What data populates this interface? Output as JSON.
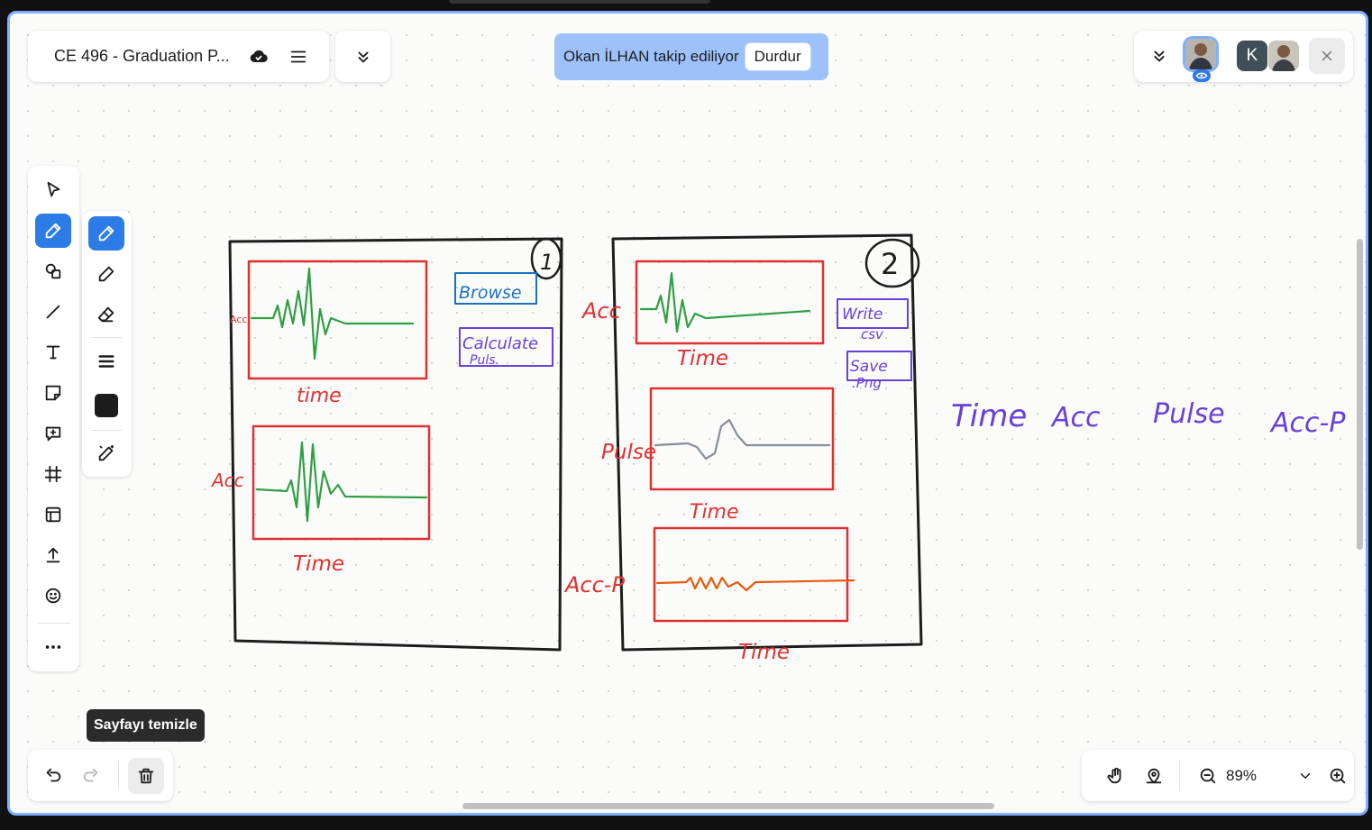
{
  "document": {
    "title": "CE 496 - Graduation P..."
  },
  "follow": {
    "text": "Okan İLHAN takip ediliyor",
    "stop_label": "Durdur"
  },
  "collaborators": {
    "second_initial": "K"
  },
  "toolbar": {
    "tools": [
      "select-icon",
      "draw-icon",
      "shapes-icon",
      "line-icon",
      "text-icon",
      "sticky-note-icon",
      "comment-icon",
      "frame-icon",
      "template-icon",
      "upload-icon",
      "emoji-icon",
      "more-icon"
    ],
    "active_tool": "draw",
    "accent_color": "#2d7be6"
  },
  "pen_options": {
    "active": "pen",
    "color": "#1d1d1d"
  },
  "tooltip": {
    "text": "Sayfayı temizle"
  },
  "zoom": {
    "value": "89%"
  },
  "board": {
    "frame1": {
      "number": "1",
      "chart1_ylabel": "Acc",
      "chart1_xlabel": "time",
      "chart2_ylabel": "Acc",
      "chart2_xlabel": "Time",
      "button1": "Browse",
      "button2_line1": "Calculate",
      "button2_line2": "Puls."
    },
    "frame2": {
      "number": "2",
      "chart1_ylabel": "Acc",
      "chart1_xlabel": "Time",
      "chart2_ylabel": "Pulse",
      "chart2_xlabel": "Time",
      "chart3_ylabel": "Acc-P",
      "chart3_xlabel": "Time",
      "button1_line1": "Write",
      "button1_line2": "csv",
      "button2_line1": "Save",
      "button2_line2": ".Png"
    },
    "columns": [
      "Time",
      "Acc",
      "Pulse",
      "Acc-P"
    ],
    "colors": {
      "frame": "#1d1d1d",
      "chart_box": "#e03131",
      "label": "#e03131",
      "signal": "#2f9e44",
      "pulse": "#868e96",
      "acc_p": "#e8590c",
      "blue": "#1971c2",
      "purple": "#6741d9"
    }
  }
}
